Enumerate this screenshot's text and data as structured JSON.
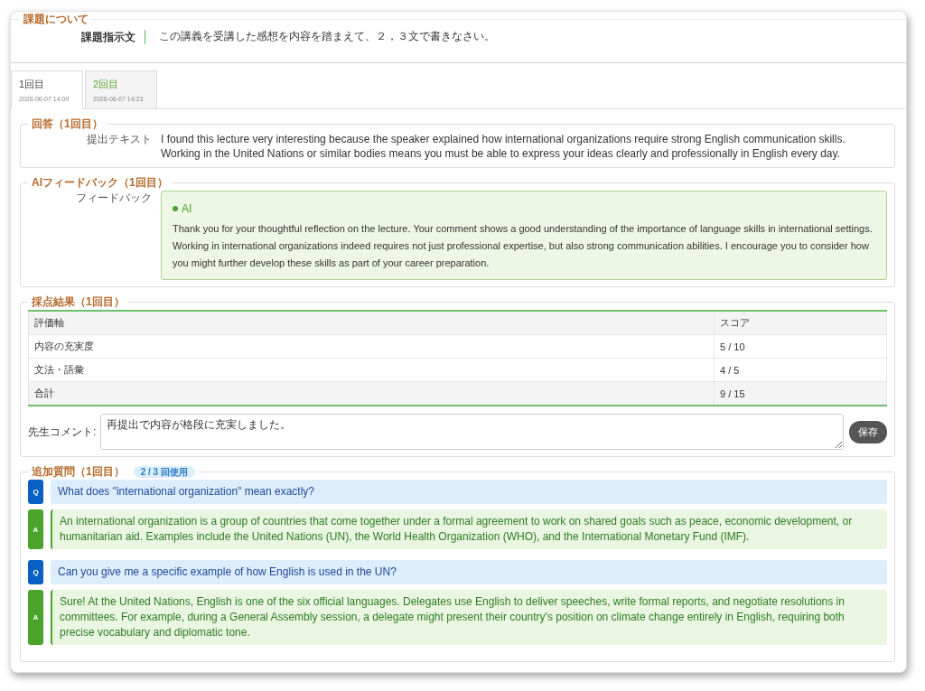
{
  "assignment": {
    "legend": "課題について",
    "label": "課題指示文",
    "text": "この講義を受講した感想を内容を踏まえて、２，３文で書きなさい。"
  },
  "tabs": [
    {
      "label": "1回目",
      "date": "2026-06-07 14:00",
      "selected": true
    },
    {
      "label": "2回目",
      "date": "2026-06-07 14:23",
      "selected": false
    }
  ],
  "answer": {
    "legend": "回答（1回目）",
    "label": "提出テキスト",
    "text": "I found this lecture very interesting because the speaker explained how international organizations require strong English communication skills. Working in the United Nations or similar bodies means you must be able to express your ideas clearly and professionally in English every day."
  },
  "feedback": {
    "legend": "AIフィードバック（1回目）",
    "label": "フィードバック",
    "badge": "AI",
    "text": "Thank you for your thoughtful reflection on the lecture. Your comment shows a good understanding of the importance of language skills in international settings. Working in international organizations indeed requires not just professional expertise, but also strong communication abilities. I encourage you to consider how you might further develop these skills as part of your career preparation."
  },
  "scoring": {
    "legend": "採点結果（1回目）",
    "columns": [
      "評価軸",
      "スコア"
    ],
    "rows": [
      {
        "criterion": "内容の充実度",
        "score": "5 / 10",
        "kind": "item"
      },
      {
        "criterion": "文法・語彙",
        "score": "4 / 5",
        "kind": "item"
      },
      {
        "criterion": "合計",
        "score": "9 / 15",
        "kind": "total"
      }
    ],
    "comment_label": "先生コメント:",
    "comment": "再提出で内容が格段に充実しました。",
    "save": "保存"
  },
  "questions": {
    "legend": "追加質問（1回目）",
    "usage": "2 / 3 回使用",
    "items": [
      {
        "kind": "q",
        "badge": "Q",
        "text": "What does \"international organization\" mean exactly?"
      },
      {
        "kind": "a",
        "badge": "A",
        "text": "An international organization is a group of countries that come together under a formal agreement to work on shared goals such as peace, economic development, or humanitarian aid. Examples include the United Nations (UN), the World Health Organization (WHO), and the International Monetary Fund (IMF)."
      },
      {
        "kind": "q",
        "badge": "Q",
        "text": "Can you give me a specific example of how English is used in the UN?"
      },
      {
        "kind": "a",
        "badge": "A",
        "text": "Sure! At the United Nations, English is one of the six official languages. Delegates use English to deliver speeches, write formal reports, and negotiate resolutions in committees. For example, during a General Assembly session, a delegate might present their country's position on climate change entirely in English, requiring both precise vocabulary and diplomatic tone."
      }
    ]
  }
}
